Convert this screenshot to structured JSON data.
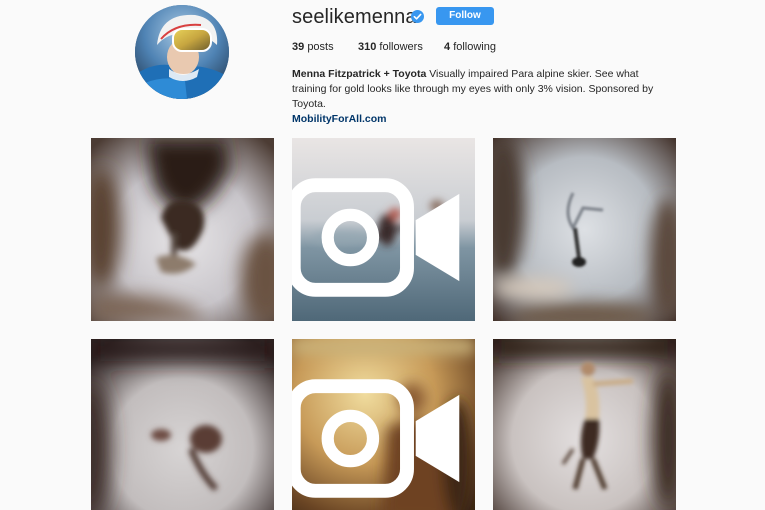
{
  "profile": {
    "username": "seelikemenna",
    "verified": true,
    "follow_label": "Follow",
    "stats": {
      "posts_count": "39",
      "posts_label": "posts",
      "followers_count": "310",
      "followers_label": "followers",
      "following_count": "4",
      "following_label": "following"
    },
    "bio": {
      "name": "Menna Fitzpatrick + Toyota",
      "text": "Visually impaired Para alpine skier. See what training for gold looks like through my eyes with only 3% vision. Sponsored by Toyota.",
      "link": "MobilityForAll.com"
    }
  },
  "posts": [
    {
      "type": "image"
    },
    {
      "type": "video"
    },
    {
      "type": "image"
    },
    {
      "type": "image"
    },
    {
      "type": "video"
    },
    {
      "type": "image"
    }
  ],
  "colors": {
    "follow_button": "#3897f0",
    "link": "#003569",
    "verified_badge": "#3897f0",
    "background": "#fafafa"
  }
}
